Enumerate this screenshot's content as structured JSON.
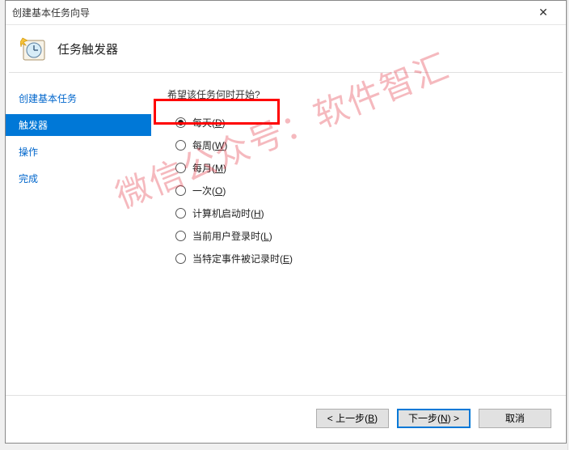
{
  "window": {
    "title": "创建基本任务向导",
    "close_glyph": "✕"
  },
  "header": {
    "title": "任务触发器"
  },
  "sidebar": {
    "items": [
      {
        "label": "创建基本任务",
        "active": false
      },
      {
        "label": "触发器",
        "active": true
      },
      {
        "label": "操作",
        "active": false
      },
      {
        "label": "完成",
        "active": false
      }
    ]
  },
  "content": {
    "prompt": "希望该任务何时开始?",
    "options": [
      {
        "label_pre": "每天(",
        "hotkey": "D",
        "label_post": ")",
        "selected": true
      },
      {
        "label_pre": "每周(",
        "hotkey": "W",
        "label_post": ")",
        "selected": false
      },
      {
        "label_pre": "每月(",
        "hotkey": "M",
        "label_post": ")",
        "selected": false
      },
      {
        "label_pre": "一次(",
        "hotkey": "O",
        "label_post": ")",
        "selected": false
      },
      {
        "label_pre": "计算机启动时(",
        "hotkey": "H",
        "label_post": ")",
        "selected": false
      },
      {
        "label_pre": "当前用户登录时(",
        "hotkey": "L",
        "label_post": ")",
        "selected": false
      },
      {
        "label_pre": "当特定事件被记录时(",
        "hotkey": "E",
        "label_post": ")",
        "selected": false
      }
    ]
  },
  "footer": {
    "back_pre": "< 上一步(",
    "back_hot": "B",
    "back_post": ")",
    "next_pre": "下一步(",
    "next_hot": "N",
    "next_post": ") >",
    "cancel": "取消"
  },
  "watermark": "微信公众号：软件智汇"
}
